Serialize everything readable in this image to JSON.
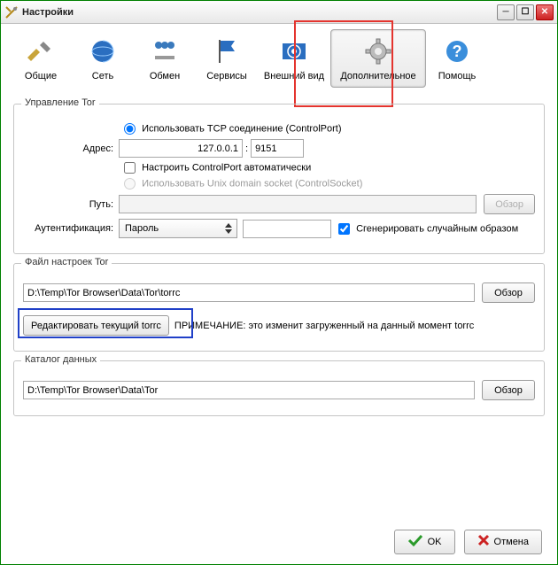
{
  "window": {
    "title": "Настройки"
  },
  "toolbar": {
    "items": [
      {
        "label": "Общие"
      },
      {
        "label": "Сеть"
      },
      {
        "label": "Обмен"
      },
      {
        "label": "Сервисы"
      },
      {
        "label": "Внешний вид"
      },
      {
        "label": "Дополнительное"
      },
      {
        "label": "Помощь"
      }
    ]
  },
  "section_control": {
    "legend": "Управление Tor",
    "use_tcp": "Использовать TCP соединение (ControlPort)",
    "address_label": "Адрес:",
    "address_value": "127.0.0.1",
    "port_value": "9151",
    "auto_config": "Настроить ControlPort автоматически",
    "use_unix": "Использовать Unix domain socket (ControlSocket)",
    "path_label": "Путь:",
    "path_value": "",
    "browse": "Обзор",
    "auth_label": "Аутентификация:",
    "auth_value": "Пароль",
    "password_value": "",
    "gen_random": "Сгенерировать случайным образом"
  },
  "section_torrc": {
    "legend": "Файл настроек Tor",
    "path_value": "D:\\Temp\\Tor Browser\\Data\\Tor\\torrc",
    "browse": "Обзор",
    "edit_button": "Редактировать текущий torrc",
    "note": "ПРИМЕЧАНИЕ: это изменит загруженный на данный момент torrc"
  },
  "section_datadir": {
    "legend": "Каталог данных",
    "path_value": "D:\\Temp\\Tor Browser\\Data\\Tor",
    "browse": "Обзор"
  },
  "footer": {
    "ok": "OK",
    "cancel": "Отмена"
  }
}
